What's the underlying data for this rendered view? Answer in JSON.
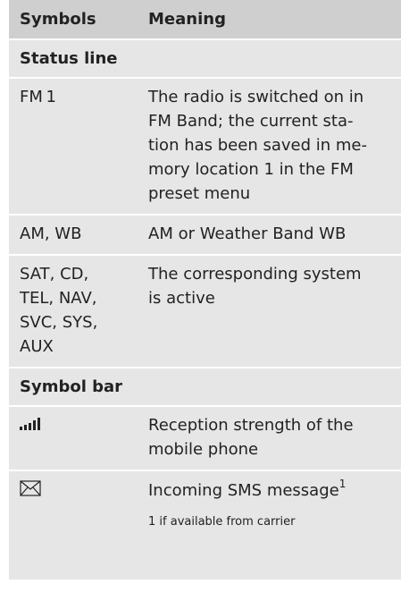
{
  "header": {
    "symbols": "Symbols",
    "meaning": "Meaning"
  },
  "sections": [
    {
      "title": "Status line",
      "rows": [
        {
          "symbol": "FM 1",
          "meaning": [
            "The radio is switched on in",
            "FM Band; the current sta-",
            "tion has been saved in me-",
            "mory location 1 in the FM",
            "preset menu"
          ]
        },
        {
          "symbol": "AM, WB",
          "meaning": [
            "AM or Weather Band WB"
          ]
        },
        {
          "symbol": [
            "SAT, CD,",
            "TEL, NAV,",
            "SVC, SYS,",
            "AUX"
          ],
          "meaning": [
            "The corresponding system",
            "is active"
          ]
        }
      ]
    },
    {
      "title": "Symbol bar",
      "rows": [
        {
          "icon": "signal-strength-icon",
          "meaning": [
            "Reception strength of the",
            "mobile phone"
          ]
        },
        {
          "icon": "envelope-icon",
          "meaning": "Incoming SMS message",
          "footnote_ref": "1"
        }
      ]
    }
  ],
  "footnote": "1 if available from carrier"
}
